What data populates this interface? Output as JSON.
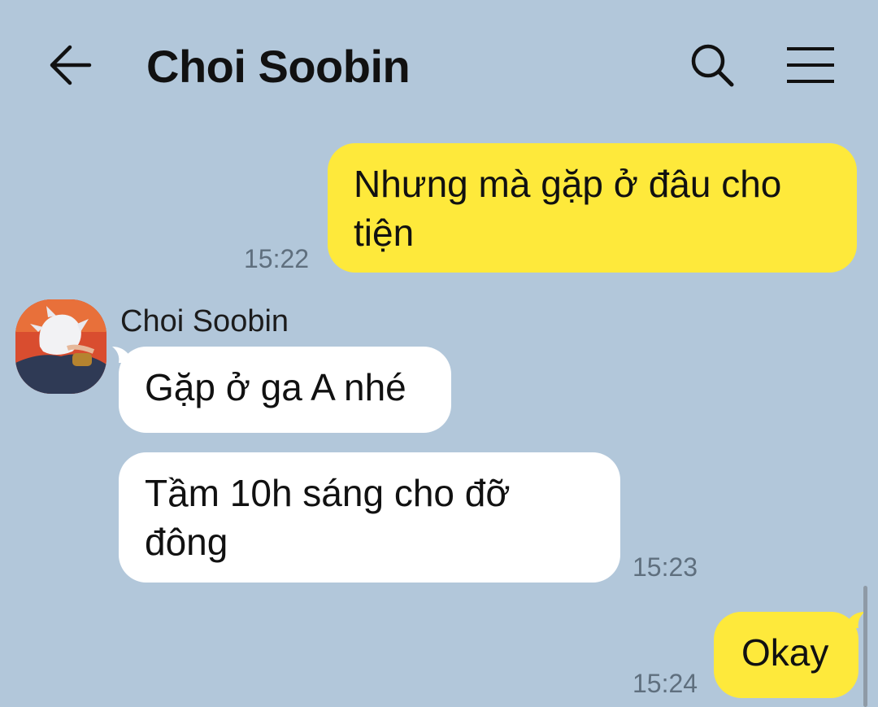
{
  "header": {
    "title": "Choi Soobin"
  },
  "icons": {
    "back": "arrow-left-icon",
    "search": "search-icon",
    "menu": "hamburger-menu-icon"
  },
  "colors": {
    "background": "#b2c7da",
    "my_bubble": "#fee93b",
    "their_bubble": "#ffffff",
    "timestamp": "#5f6f7e"
  },
  "messages": [
    {
      "sender": "me",
      "line1": "Nhưng mà gặp ở đâu cho",
      "line2": "tiện",
      "time": "15:22"
    },
    {
      "sender": "Choi Soobin",
      "text": "Gặp ở ga A nhé"
    },
    {
      "sender": "Choi Soobin",
      "line1": "Tầm 10h sáng cho đỡ",
      "line2": "đông",
      "time": "15:23"
    },
    {
      "sender": "me",
      "text": "Okay",
      "time": "15:24"
    }
  ]
}
